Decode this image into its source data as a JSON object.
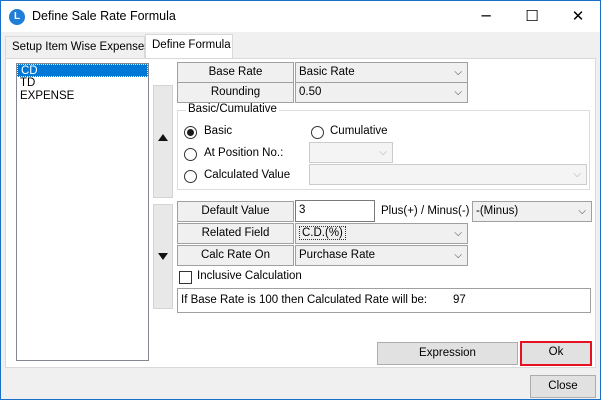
{
  "window": {
    "title": "Define Sale Rate Formula",
    "minimize_glyph": "─",
    "maximize_glyph": "☐",
    "close_glyph": "✕"
  },
  "tabs": [
    {
      "label": "Setup Item Wise Expenses"
    },
    {
      "label": "Define Formula"
    }
  ],
  "list": {
    "items": [
      "CD",
      "TD",
      "EXPENSE"
    ]
  },
  "form": {
    "base_rate_label": "Base Rate",
    "base_rate_value": "Basic Rate",
    "rounding_label": "Rounding",
    "rounding_value": "0.50",
    "group_title": "Basic/Cumulative",
    "radio_basic": "Basic",
    "radio_cumulative": "Cumulative",
    "radio_position": "At Position No.:",
    "radio_calculated": "Calculated Value",
    "position_value": "",
    "calculated_value": "",
    "default_value_label": "Default Value",
    "default_value": "3",
    "plus_minus_label": "Plus(+) / Minus(-)",
    "plus_minus_value": "-(Minus)",
    "related_field_label": "Related Field",
    "related_field_value": "C.D.(%)",
    "calc_rate_on_label": "Calc Rate On",
    "calc_rate_on_value": "Purchase Rate",
    "inclusive_label": "Inclusive Calculation",
    "info_text": "If Base Rate is 100 then Calculated Rate will be:",
    "info_value": "97"
  },
  "buttons": {
    "expression": "Expression",
    "ok": "Ok",
    "close": "Close"
  },
  "icons": {
    "chevron": "⌵"
  },
  "colors": {
    "selection": "#0078d7",
    "focus_border": "#e81123",
    "window_border": "#1a6fc9"
  }
}
